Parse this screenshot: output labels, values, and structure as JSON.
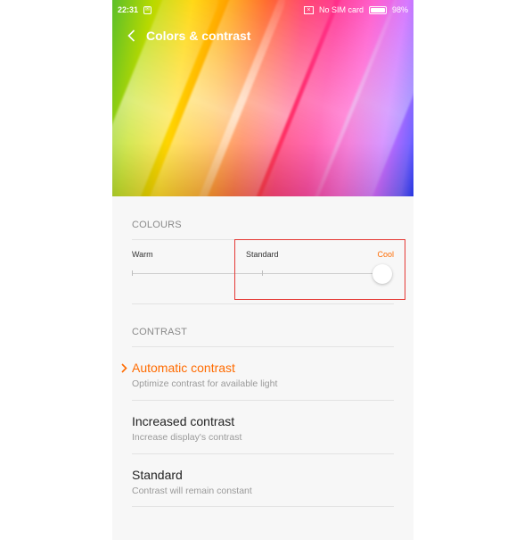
{
  "status_bar": {
    "time": "22:31",
    "notification_glyph": "✉",
    "sim_glyph": "×",
    "sim_status": "No SIM card",
    "battery": "98%"
  },
  "header": {
    "title": "Colors & contrast"
  },
  "colours": {
    "section_label": "COLOURS",
    "slider": {
      "warm_label": "Warm",
      "standard_label": "Standard",
      "cool_label": "Cool",
      "selected": "Cool",
      "level": 1.0
    }
  },
  "contrast": {
    "section_label": "CONTRAST",
    "options": [
      {
        "title": "Automatic contrast",
        "subtitle": "Optimize contrast for available light",
        "selected": true
      },
      {
        "title": "Increased contrast",
        "subtitle": "Increase display's contrast",
        "selected": false
      },
      {
        "title": "Standard",
        "subtitle": "Contrast will remain constant",
        "selected": false
      }
    ]
  },
  "colors": {
    "accent": "#ff6b00",
    "highlight_box": "#e53935"
  }
}
